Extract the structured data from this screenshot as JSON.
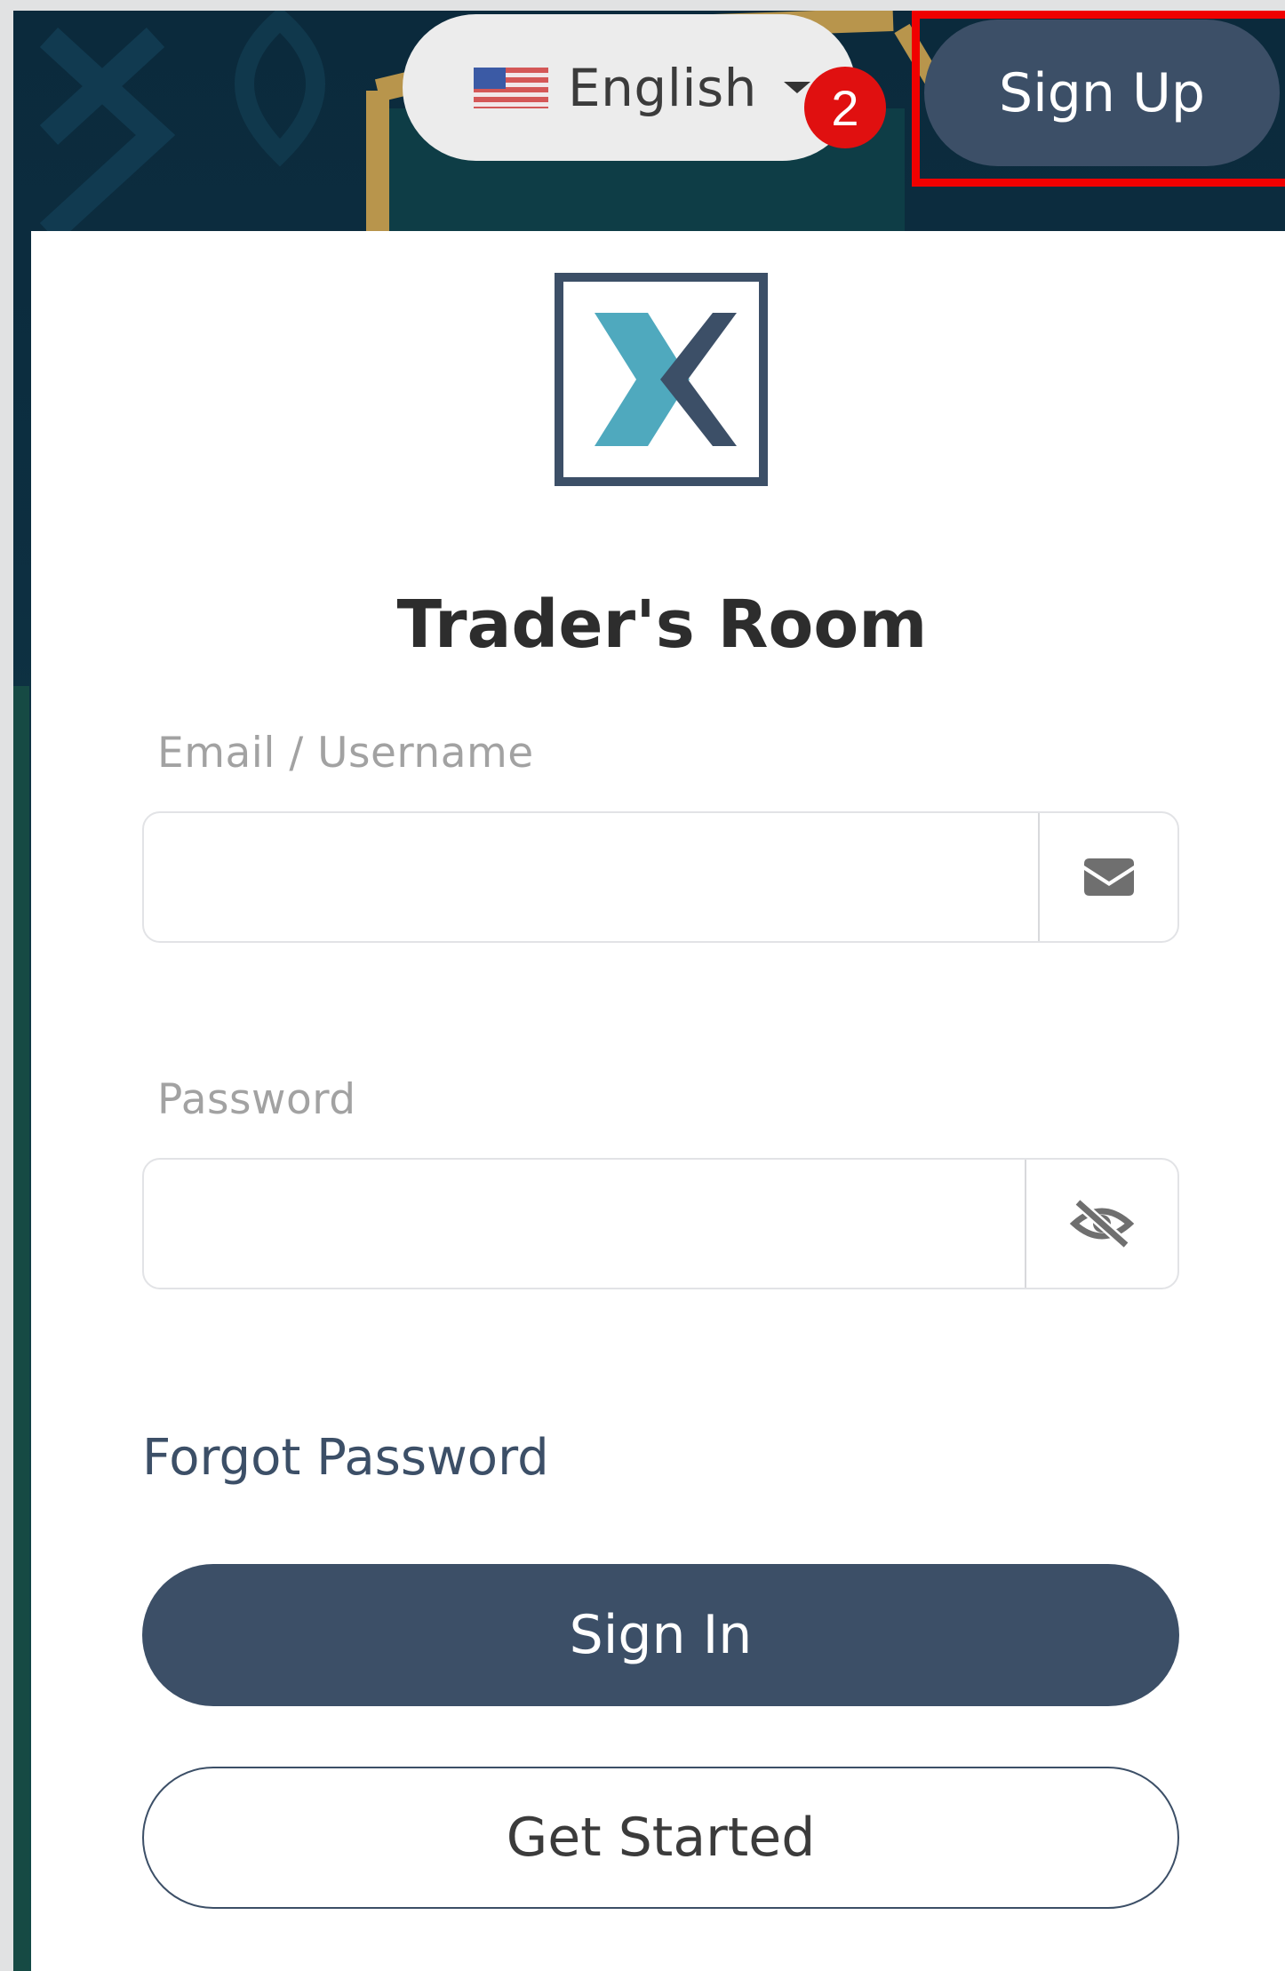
{
  "header": {
    "language": {
      "label": "English",
      "flag_icon": "us-flag-icon",
      "caret_icon": "caret-down-icon"
    },
    "step_badge": "2",
    "signup_label": "Sign Up"
  },
  "login": {
    "logo_icon": "x-logo-icon",
    "title": "Trader's Room",
    "email": {
      "label": "Email / Username",
      "value": "",
      "icon": "envelope-icon"
    },
    "password": {
      "label": "Password",
      "value": "",
      "icon": "eye-slash-icon"
    },
    "forgot_label": "Forgot Password",
    "signin_label": "Sign In",
    "getstarted_label": "Get Started"
  },
  "colors": {
    "primary": "#3c4f67",
    "background_dark": "#0d2f41",
    "gold_accent": "#b8954c",
    "annotation_red": "#f00000",
    "logo_teal": "#4fa9be"
  }
}
